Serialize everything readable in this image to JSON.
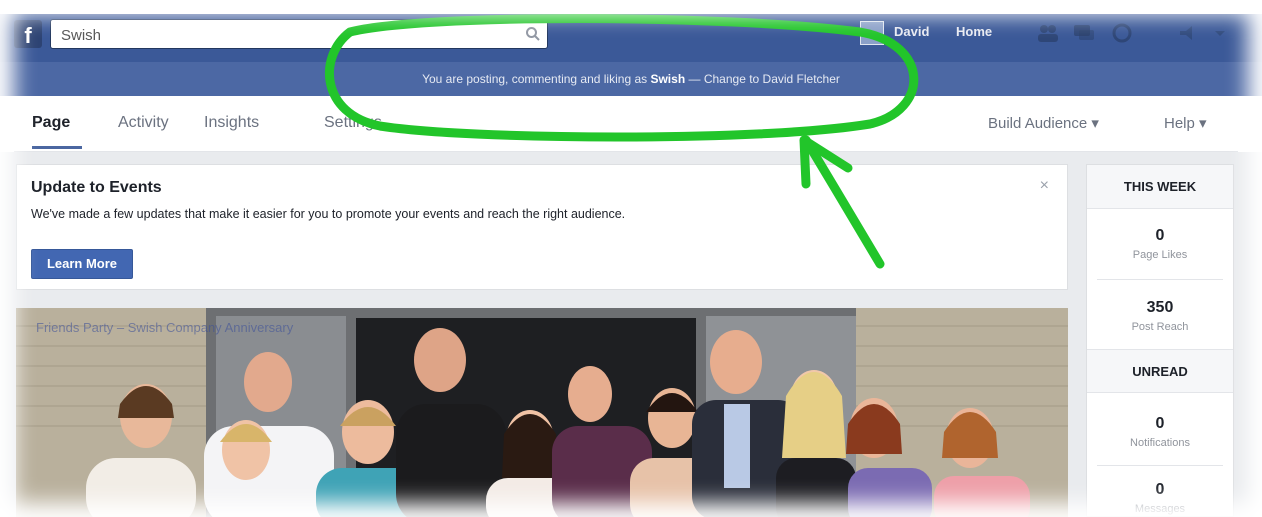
{
  "header": {
    "search_value": "Swish",
    "user_name": "David",
    "home_label": "Home",
    "icons": [
      "friends-icon",
      "messages-icon",
      "notifications-icon",
      "privacy-icon",
      "account-menu-icon"
    ]
  },
  "posting_bar": {
    "prefix": "You are posting, commenting and liking as ",
    "page_name": "Swish",
    "separator": " — ",
    "change_link": "Change to David Fletcher"
  },
  "tabs": {
    "items": [
      "Page",
      "Activity",
      "Insights",
      "Settings"
    ],
    "active": "Page",
    "build_audience": "Build Audience ▾",
    "help": "Help ▾"
  },
  "events_card": {
    "title": "Update to Events",
    "body": "We've made a few updates that make it easier for you to promote your events and reach the right audience.",
    "button": "Learn More",
    "close": "×"
  },
  "cover": {
    "caption": "Friends Party – Swish Company Anniversary"
  },
  "sidebar": {
    "this_week": "THIS WEEK",
    "page_likes_value": "0",
    "page_likes_label": "Page Likes",
    "post_reach_value": "350",
    "post_reach_label": "Post Reach",
    "unread": "UNREAD",
    "notifications_value": "0",
    "notifications_label": "Notifications",
    "messages_value": "0",
    "messages_label": "Messages"
  },
  "colors": {
    "brand_blue": "#3b5998",
    "annotation_green": "#22c52a"
  }
}
